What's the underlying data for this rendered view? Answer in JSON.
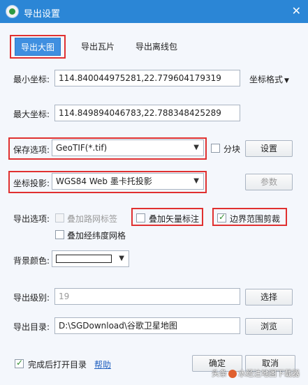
{
  "window": {
    "title": "导出设置",
    "close_glyph": "✕"
  },
  "tabs": [
    {
      "label": "导出大图",
      "active": true
    },
    {
      "label": "导出瓦片",
      "active": false
    },
    {
      "label": "导出离线包",
      "active": false
    }
  ],
  "coords": {
    "min_label": "最小坐标:",
    "min_value": "114.840044975281,22.779604179319",
    "max_label": "最大坐标:",
    "max_value": "114.849894046783,22.788348425289",
    "format_label": "坐标格式",
    "format_arrow": "▼"
  },
  "save": {
    "label": "保存选项:",
    "selected": "GeoTIF(*.tif)",
    "split_label": "分块",
    "settings_button": "设置"
  },
  "projection": {
    "label": "坐标投影:",
    "selected": "WGS84 Web 墨卡托投影",
    "params_button": "参数"
  },
  "export_options": {
    "label": "导出选项:",
    "road_labels": {
      "label": "叠加路网标签",
      "checked": false,
      "enabled": false
    },
    "vector_labels": {
      "label": "叠加矢量标注",
      "checked": false,
      "enabled": true
    },
    "boundary_clip": {
      "label": "边界范围剪裁",
      "checked": true,
      "enabled": true
    },
    "latlng_grid": {
      "label": "叠加经纬度网格",
      "checked": false,
      "enabled": true
    }
  },
  "background": {
    "label": "背景颜色:",
    "color": "#ffffff"
  },
  "level": {
    "label": "导出级别:",
    "value": "19",
    "select_button": "选择"
  },
  "directory": {
    "label": "导出目录:",
    "value": "D:\\SGDownload\\谷歌卫星地图",
    "browse_button": "浏览"
  },
  "footer": {
    "open_after_label": "完成后打开目录",
    "open_after_checked": true,
    "help_link": "帮助",
    "ok_button": "确定",
    "cancel_button": "取消"
  },
  "watermark": {
    "text_prefix": "头条",
    "text_suffix": "水经注地图下载器"
  },
  "colors": {
    "titlebar": "#2b86d6",
    "tab_active": "#3f8fe0",
    "highlight_box": "#e03030",
    "check": "#2f8d2f",
    "link": "#1f5fbf"
  }
}
